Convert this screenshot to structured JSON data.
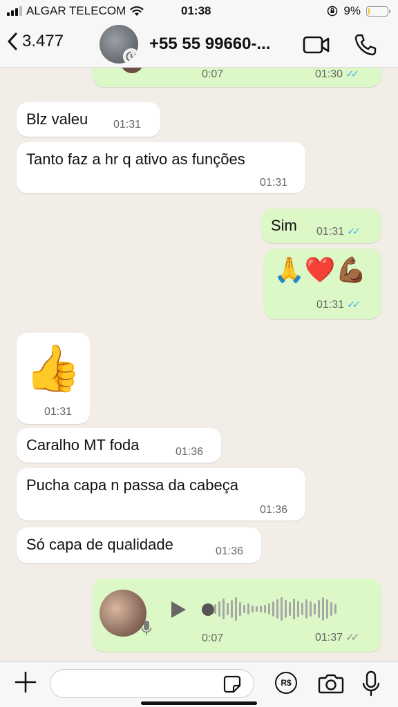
{
  "status_bar": {
    "carrier": "ALGAR TELECOM",
    "time": "01:38",
    "battery": "9%",
    "battery_level": 0.09
  },
  "header": {
    "back_count": "3.477",
    "contact_name": "+55 55 99660-...",
    "icons": [
      "back-chevron-icon",
      "video-camera-icon",
      "phone-icon"
    ]
  },
  "messages": [
    {
      "dir": "out",
      "type": "voice",
      "duration": "0:07",
      "time": "01:30",
      "read": true
    },
    {
      "dir": "in",
      "text": "Blz valeu",
      "time": "01:31"
    },
    {
      "dir": "in",
      "text": "Tanto faz a hr q ativo as funções",
      "time": "01:31"
    },
    {
      "dir": "out",
      "text": "Sim",
      "time": "01:31",
      "read": true
    },
    {
      "dir": "out",
      "text": "🙏❤️💪🏾",
      "time": "01:31",
      "read": true
    },
    {
      "dir": "in",
      "text": "👍",
      "time": "01:31"
    },
    {
      "dir": "in",
      "text": "Caralho MT foda",
      "time": "01:36"
    },
    {
      "dir": "in",
      "text": "Pucha capa n passa da cabeça",
      "time": "01:36"
    },
    {
      "dir": "in",
      "text": "Só capa de qualidade",
      "time": "01:36"
    },
    {
      "dir": "out",
      "type": "voice",
      "duration": "0:07",
      "time": "01:37",
      "read": false
    }
  ],
  "input": {
    "placeholder": "",
    "pix_label": "R$"
  },
  "colors": {
    "outgoing_bubble": "#dcf8c6",
    "incoming_bubble": "#ffffff",
    "read_ticks": "#4fb6ec",
    "chat_background": "#f2ede6"
  }
}
